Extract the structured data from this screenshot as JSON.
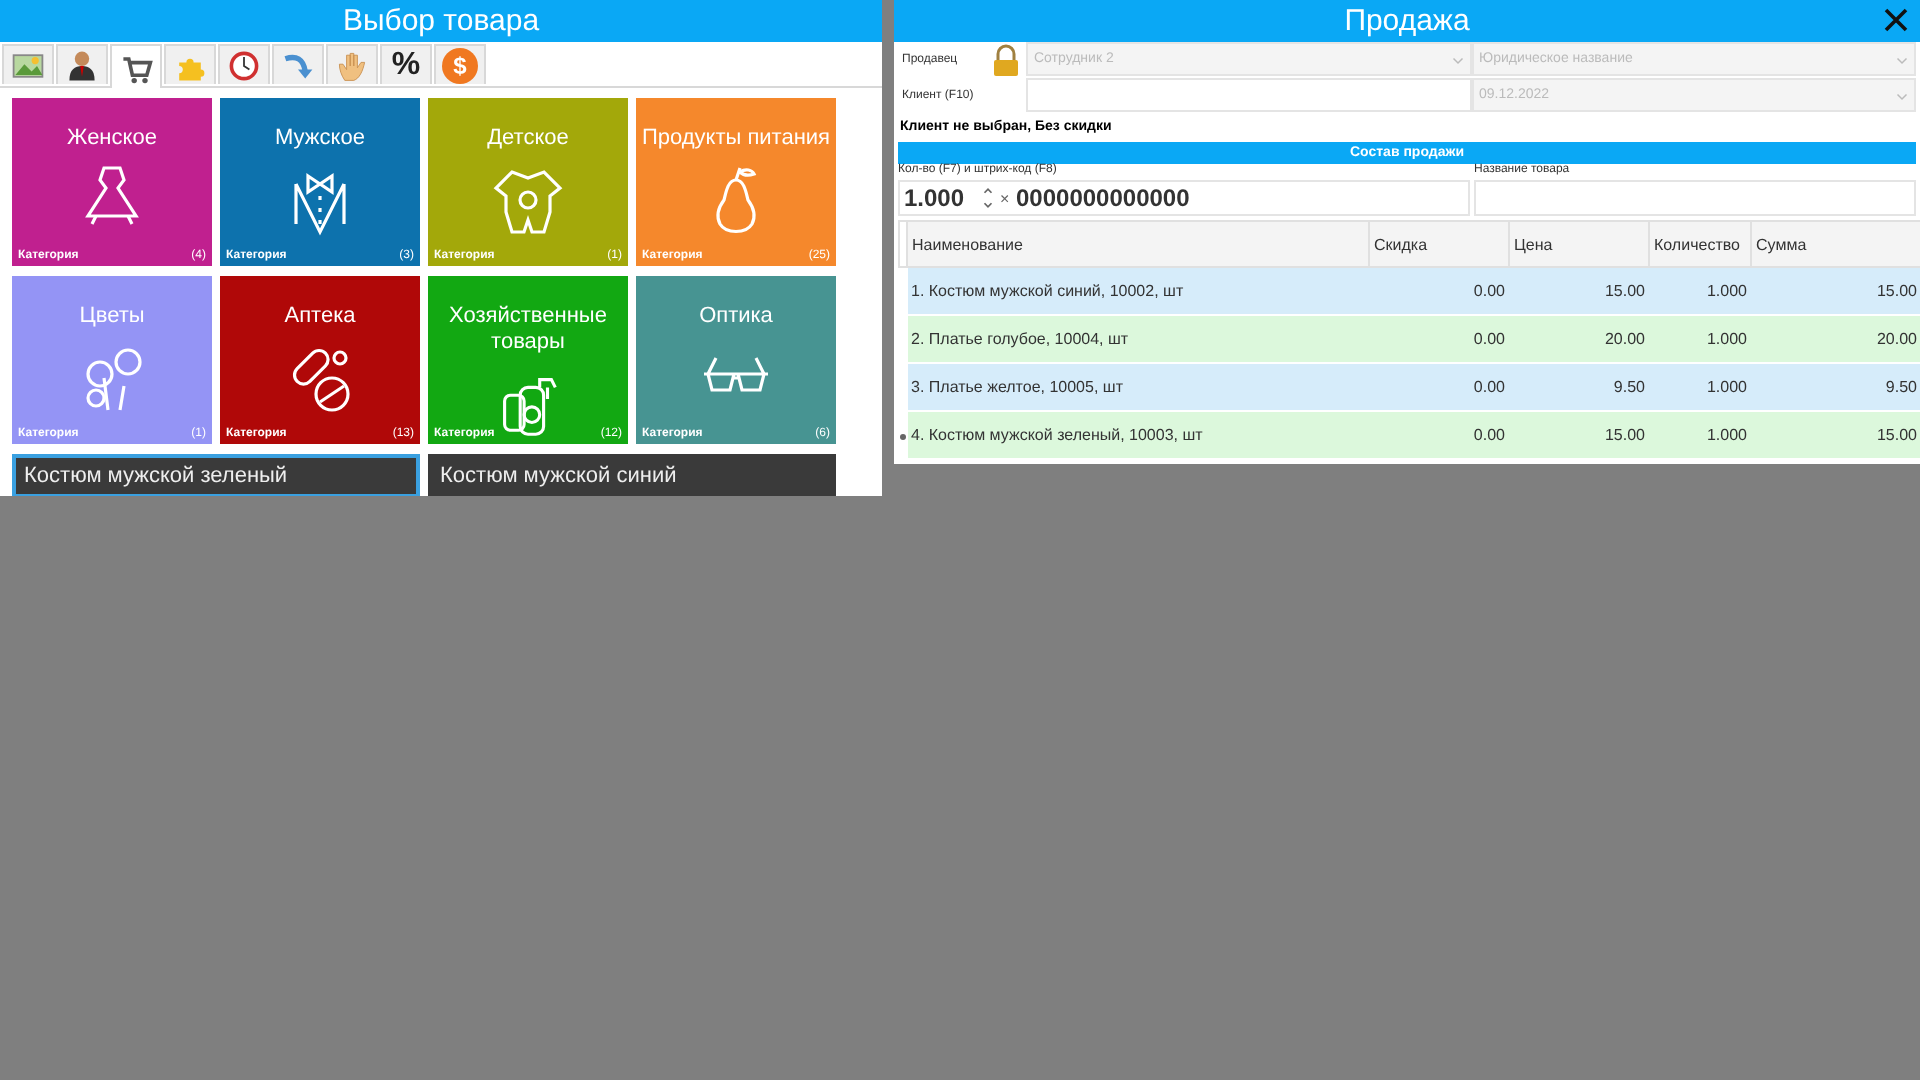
{
  "left_panel": {
    "title": "Выбор товара",
    "tabs": [
      {
        "selected": false
      },
      {
        "selected": false
      },
      {
        "selected": true
      },
      {
        "selected": false
      },
      {
        "selected": false
      },
      {
        "selected": false
      },
      {
        "selected": false
      },
      {
        "label": "%",
        "selected": false
      },
      {
        "label": "$",
        "selected": false
      }
    ],
    "categories": [
      {
        "name": "Женское",
        "caption": "Категория",
        "count": "(4)",
        "color": "#c0208f"
      },
      {
        "name": "Мужское",
        "caption": "Категория",
        "count": "(3)",
        "color": "#0d72ad"
      },
      {
        "name": "Детское",
        "caption": "Категория",
        "count": "(1)",
        "color": "#a3a80a"
      },
      {
        "name": "Продукты питания",
        "caption": "Категория",
        "count": "(25)",
        "color": "#f5882c"
      },
      {
        "name": "Цветы",
        "caption": "Категория",
        "count": "(1)",
        "color": "#9494f5"
      },
      {
        "name": "Аптека",
        "caption": "Категория",
        "count": "(13)",
        "color": "#b00808"
      },
      {
        "name": "Хозяйственные товары",
        "caption": "Категория",
        "count": "(12)",
        "color": "#12a812"
      },
      {
        "name": "Оптика",
        "caption": "Категория",
        "count": "(6)",
        "color": "#479492"
      }
    ],
    "products": [
      {
        "name": "Костюм мужской зеленый",
        "selected": true
      },
      {
        "name": "Костюм мужской синий",
        "selected": false
      }
    ]
  },
  "sale_panel": {
    "title": "Продажа",
    "seller_label": "Продавец",
    "seller": "Сотрудник 2",
    "legal_name": "Юридическое название",
    "client_label": "Клиент (F10)",
    "date": "09.12.2022",
    "client_status": "Клиент не выбран, Без скидки",
    "section_title": "Состав продажи",
    "barcode_label": "Кол-во (F7) и штрих-код (F8)",
    "quantity": "1.000",
    "times": "×",
    "barcode": "0000000000000",
    "product_name_label": "Название товара",
    "table": {
      "columns": [
        "Наименование",
        "Скидка",
        "Цена",
        "Количество",
        "Сумма"
      ],
      "rows": [
        {
          "cells": [
            "1. Костюм мужской синий, 10002, шт",
            "0.00",
            "15.00",
            "1.000",
            "15.00"
          ],
          "current": false
        },
        {
          "cells": [
            "2. Платье голубое, 10004, шт",
            "0.00",
            "20.00",
            "1.000",
            "20.00"
          ],
          "current": false
        },
        {
          "cells": [
            "3. Платье желтое, 10005, шт",
            "0.00",
            "9.50",
            "1.000",
            "9.50"
          ],
          "current": false
        },
        {
          "cells": [
            "4. Костюм мужской зеленый, 10003, шт",
            "0.00",
            "15.00",
            "1.000",
            "15.00"
          ],
          "current": true
        }
      ]
    }
  }
}
